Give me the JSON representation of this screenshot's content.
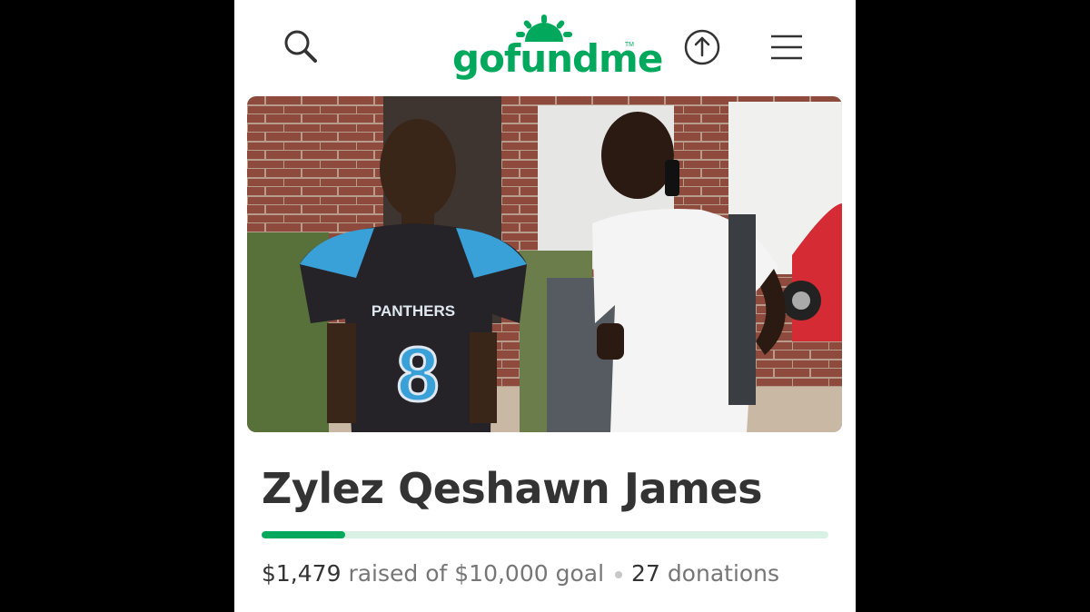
{
  "header": {
    "logo_text": "gofundme",
    "logo_tm": "TM",
    "icons": [
      "search-icon",
      "share-icon",
      "menu-icon"
    ],
    "brand_color": "#02a95c"
  },
  "campaign": {
    "title": "Zylez Qeshawn James",
    "raised": "$1,479",
    "raised_label": "raised of",
    "goal": "$10,000",
    "goal_label": "goal",
    "donations_count": "27",
    "donations_label": "donations",
    "progress_fraction": 0.1479
  },
  "photo": {
    "jersey_text": "PANTHERS",
    "jersey_number": "8"
  }
}
